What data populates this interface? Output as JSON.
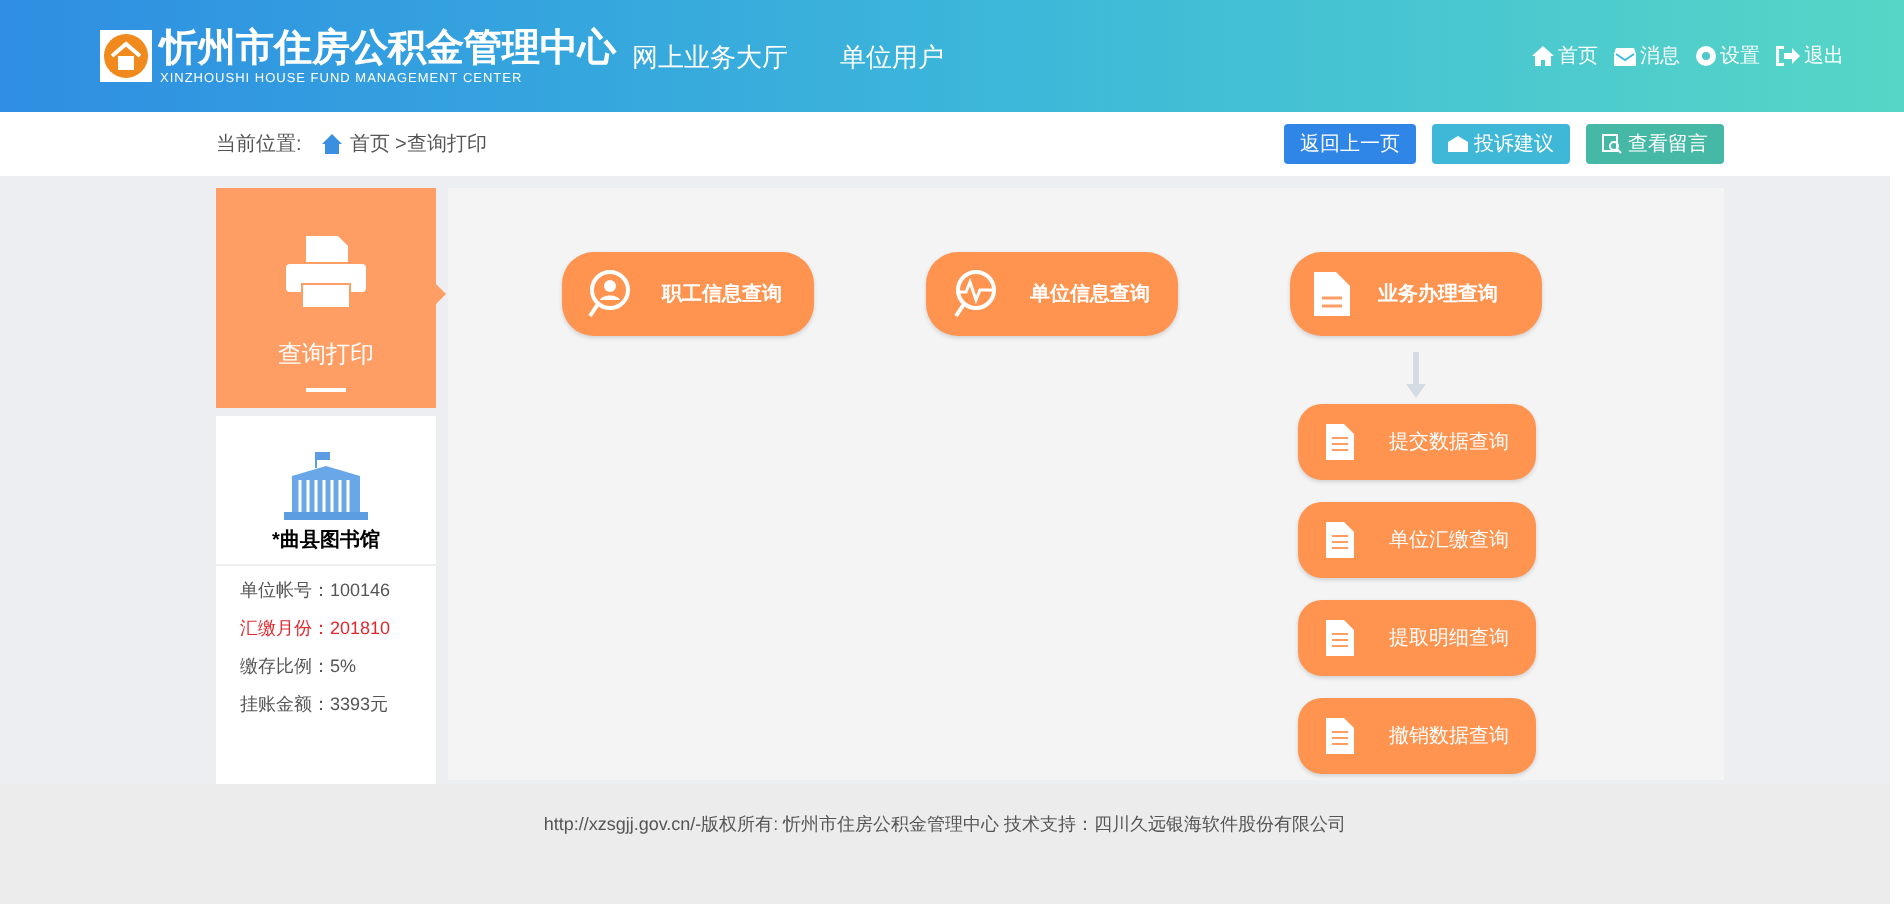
{
  "header": {
    "logo_title": "忻州市住房公积金管理中心",
    "logo_subtitle": "XINZHOUSHI HOUSE FUND MANAGEMENT CENTER",
    "hall": "网上业务大厅",
    "user_type": "单位用户",
    "nav": [
      {
        "label": "首页"
      },
      {
        "label": "消息"
      },
      {
        "label": "设置"
      },
      {
        "label": "退出"
      }
    ]
  },
  "breadcrumb": {
    "label": "当前位置:",
    "path": "首页 >查询打印"
  },
  "actions": [
    {
      "label": "返回上一页",
      "color": "#2f86e6"
    },
    {
      "label": "投诉建议",
      "color": "#3fb8d8"
    },
    {
      "label": "查看留言",
      "color": "#45b9a6"
    }
  ],
  "sidebar": {
    "items": [
      {
        "label": "查询打印",
        "selected": true
      }
    ],
    "unit": {
      "name": "*曲县图书馆",
      "info": [
        {
          "text": "单位帐号：100146",
          "highlighted": false
        },
        {
          "text": "汇缴月份：201810",
          "highlighted": true
        },
        {
          "text": "缴存比例：5%",
          "highlighted": false
        },
        {
          "text": "挂账金额：3393元",
          "highlighted": false
        }
      ]
    }
  },
  "queries": [
    {
      "label": "职工信息查询"
    },
    {
      "label": "单位信息查询"
    },
    {
      "label": "业务办理查询",
      "children": [
        {
          "label": "提交数据查询"
        },
        {
          "label": "单位汇缴查询"
        },
        {
          "label": "提取明细查询"
        },
        {
          "label": "撤销数据查询"
        }
      ]
    }
  ],
  "footer": "http://xzsgjj.gov.cn/-版权所有:  忻州市住房公积金管理中心 技术支持：四川久远银海软件股份有限公司"
}
